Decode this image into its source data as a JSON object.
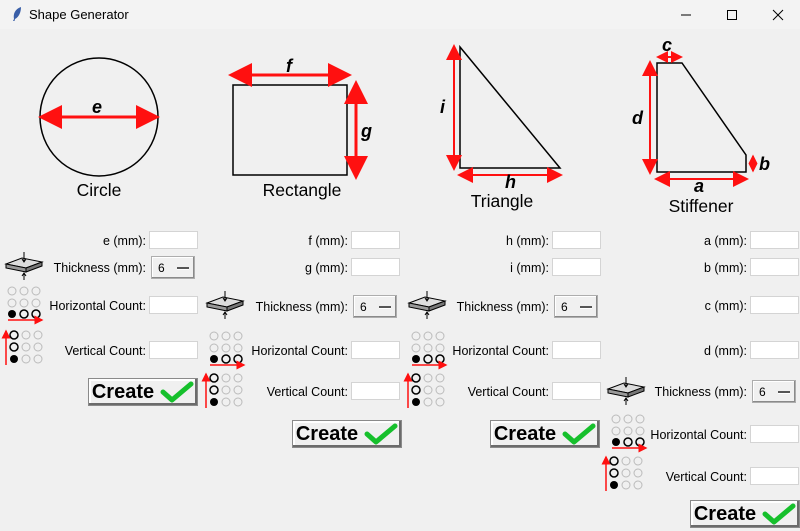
{
  "window": {
    "title": "Shape Generator",
    "minimize_icon": "minimize-icon",
    "maximize_icon": "maximize-icon",
    "close_icon": "close-icon"
  },
  "shapes": {
    "circle": {
      "title": "Circle",
      "dim_label": "e",
      "fields": {
        "e": "e (mm):",
        "thickness": "Thickness (mm):",
        "hcount": "Horizontal Count:",
        "vcount": "Vertical Count:"
      },
      "thickness_value": "6",
      "create_label": "Create"
    },
    "rectangle": {
      "title": "Rectangle",
      "dim_f": "f",
      "dim_g": "g",
      "fields": {
        "f": "f (mm):",
        "g": "g (mm):",
        "thickness": "Thickness (mm):",
        "hcount": "Horizontal Count:",
        "vcount": "Vertical Count:"
      },
      "thickness_value": "6",
      "create_label": "Create"
    },
    "triangle": {
      "title": "Triangle",
      "dim_h": "h",
      "dim_i": "i",
      "fields": {
        "h": "h (mm):",
        "i": "i (mm):",
        "thickness": "Thickness (mm):",
        "hcount": "Horizontal Count:",
        "vcount": "Vertical Count:"
      },
      "thickness_value": "6",
      "create_label": "Create"
    },
    "stiffener": {
      "title": "Stiffener",
      "dim_a": "a",
      "dim_b": "b",
      "dim_c": "c",
      "dim_d": "d",
      "fields": {
        "a": "a (mm):",
        "b": "b (mm):",
        "c": "c (mm):",
        "d": "d (mm):",
        "thickness": "Thickness (mm):",
        "hcount": "Horizontal Count:",
        "vcount": "Vertical Count:"
      },
      "thickness_value": "6",
      "create_label": "Create"
    }
  },
  "colors": {
    "arrow": "#ff1010",
    "check": "#16c02c"
  }
}
